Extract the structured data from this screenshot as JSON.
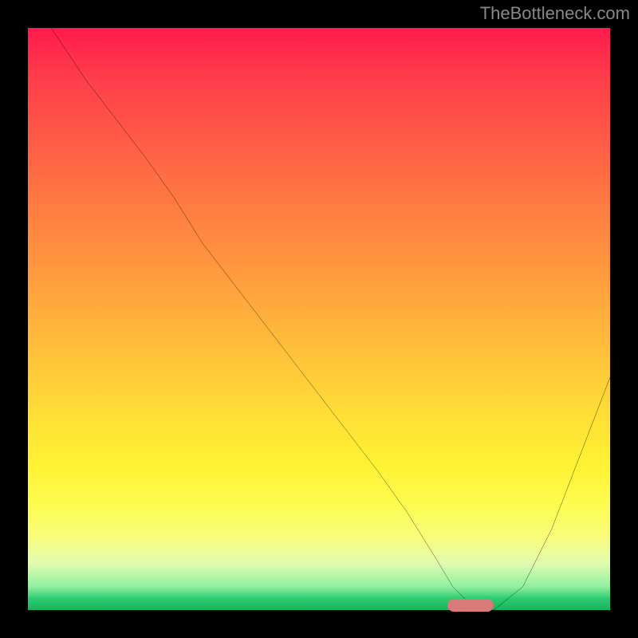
{
  "watermark": "TheBottleneck.com",
  "chart_data": {
    "type": "line",
    "title": "",
    "xlabel": "",
    "ylabel": "",
    "xlim": [
      0,
      100
    ],
    "ylim": [
      0,
      100
    ],
    "series": [
      {
        "name": "curve",
        "x": [
          4,
          10,
          20,
          25,
          30,
          40,
          50,
          60,
          65,
          70,
          73,
          76,
          80,
          85,
          90,
          95,
          100
        ],
        "values": [
          100,
          91,
          78,
          71,
          63,
          50,
          37,
          24,
          17,
          9,
          4,
          1,
          0,
          4,
          14,
          27,
          40
        ]
      }
    ],
    "marker": {
      "x_start": 72,
      "x_end": 80,
      "y": 0
    },
    "gradient_note": "Background encodes severity: red=high (top) to green=low (bottom)"
  }
}
